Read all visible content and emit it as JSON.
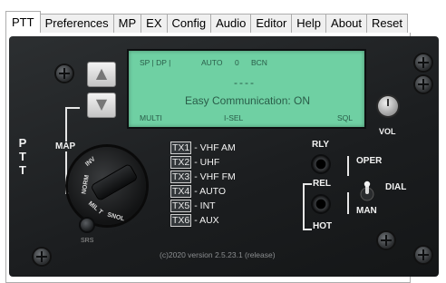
{
  "tabs": [
    "PTT",
    "Preferences",
    "MP",
    "EX",
    "Config",
    "Audio",
    "Editor",
    "Help",
    "About",
    "Reset"
  ],
  "active_tab": "PTT",
  "lcd": {
    "top_left": "SP | DP |",
    "top_mode": "AUTO",
    "top_num": "0",
    "top_bcn": "BCN",
    "dashes": "----",
    "status": "Easy Communication: ON",
    "bottom_left": "MULTI",
    "bottom_mid": "I-SEL",
    "bottom_right": "SQL"
  },
  "side_label": "PTT",
  "map_label": "MAP",
  "knob_labels": {
    "inv": "INV",
    "norm": "NORM",
    "mil": "MIL T",
    "snol": "SNOL"
  },
  "srs_label": "SRS",
  "tx": [
    {
      "id": "TX1",
      "label": "- VHF AM"
    },
    {
      "id": "TX2",
      "label": "- UHF"
    },
    {
      "id": "TX3",
      "label": "- VHF FM"
    },
    {
      "id": "TX4",
      "label": "- AUTO"
    },
    {
      "id": "TX5",
      "label": "- INT"
    },
    {
      "id": "TX6",
      "label": "- AUX"
    }
  ],
  "right_labels": {
    "vol": "VOL",
    "rly": "RLY",
    "oper": "OPER",
    "rel": "REL",
    "dial": "DIAL",
    "man": "MAN",
    "hot": "HOT"
  },
  "footer": "(c)2020 version 2.5.23.1 (release)",
  "arrows": {
    "up": "▲",
    "down": "▼"
  }
}
